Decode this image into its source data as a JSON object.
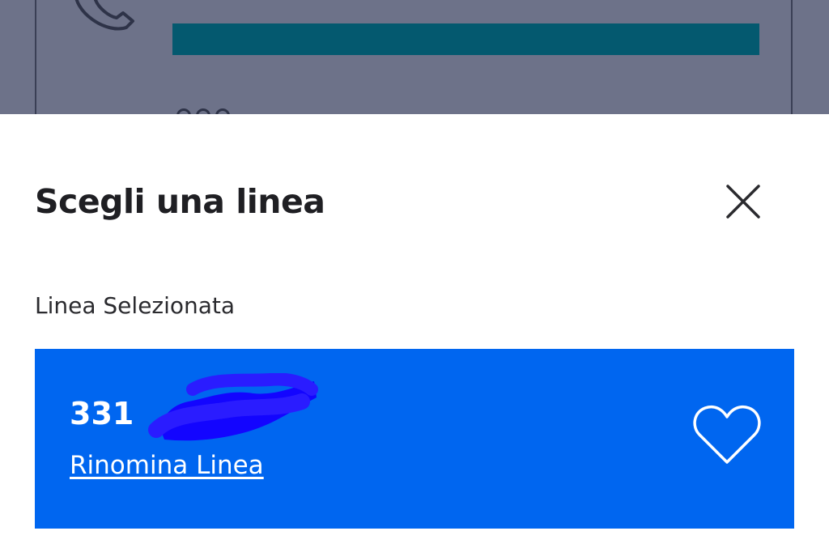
{
  "sheet": {
    "title": "Scegli una linea",
    "section_label": "Linea Selezionata"
  },
  "selected_line": {
    "number_visible": "331",
    "rename_label": "Rinomina Linea",
    "favorite_icon": "heart-outline-icon"
  },
  "icons": {
    "close": "close-icon",
    "phone": "phone-icon"
  },
  "colors": {
    "backdrop": "#6d7289",
    "card_accent": "#0066f0",
    "background_bar": "#04596f",
    "text_dark": "#1f1f23"
  }
}
